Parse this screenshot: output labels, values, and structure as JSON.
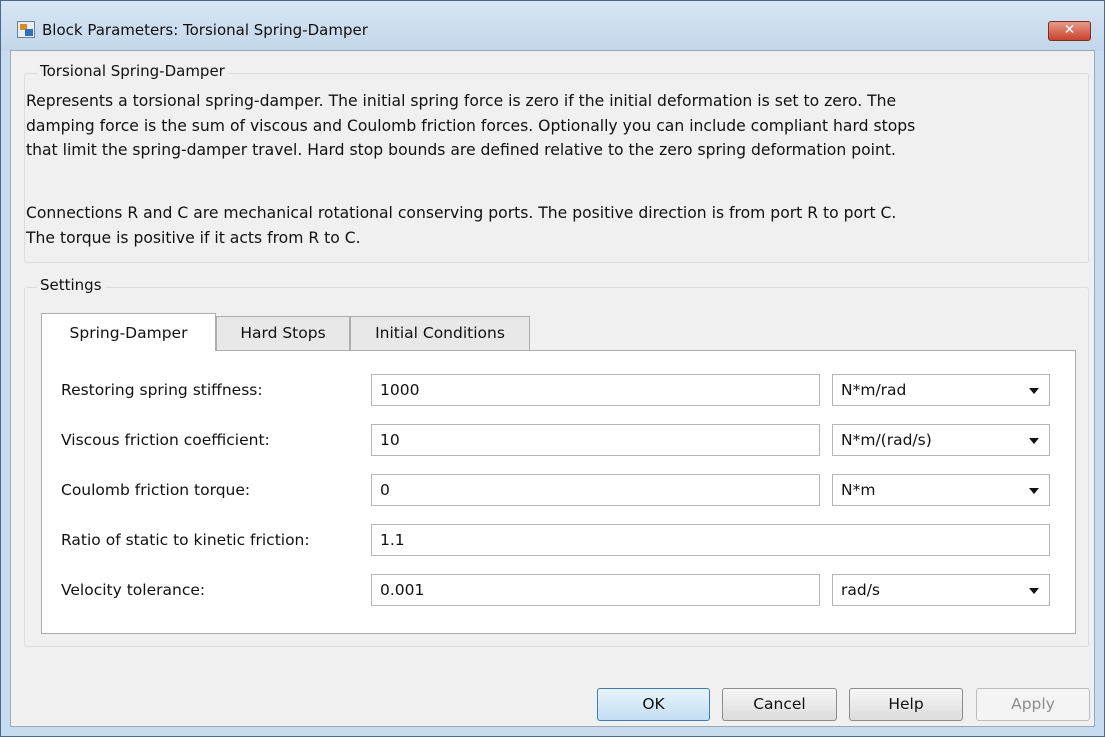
{
  "window": {
    "title": "Block Parameters: Torsional Spring-Damper",
    "close_label": "✕"
  },
  "description_group": {
    "title": "Torsional Spring-Damper",
    "lines": [
      "Represents a torsional spring-damper. The initial spring force is zero if the initial deformation is set to zero. The",
      "damping force is the sum of viscous and Coulomb friction forces. Optionally you can include compliant hard stops",
      "that limit the spring-damper travel. Hard stop bounds are defined relative to the zero spring deformation point.",
      "Connections R and C are mechanical rotational conserving ports. The positive direction is from port R to port C.",
      "The torque is positive if it acts from R to C."
    ]
  },
  "settings": {
    "title": "Settings",
    "tabs": [
      {
        "label": "Spring-Damper",
        "active": true
      },
      {
        "label": "Hard Stops",
        "active": false
      },
      {
        "label": "Initial Conditions",
        "active": false
      }
    ],
    "parameters": [
      {
        "label": "Restoring spring stiffness:",
        "value": "1000",
        "unit": "N*m/rad"
      },
      {
        "label": "Viscous friction coefficient:",
        "value": "10",
        "unit": "N*m/(rad/s)"
      },
      {
        "label": "Coulomb friction torque:",
        "value": "0",
        "unit": "N*m"
      },
      {
        "label": "Ratio of static to kinetic friction:",
        "value": "1.1",
        "unit": ""
      },
      {
        "label": "Velocity tolerance:",
        "value": "0.001",
        "unit": "rad/s"
      }
    ]
  },
  "buttons": {
    "ok": "OK",
    "cancel": "Cancel",
    "help": "Help",
    "apply": "Apply"
  },
  "colors": {
    "window_frame": "#c9dcef",
    "client_background": "#f0f0f0",
    "close_button": "#c8432d",
    "default_button_border": "#3c7fb1"
  },
  "icons": {
    "app": "block-parameters-icon",
    "close": "close-icon",
    "dropdown": "chevron-down-icon"
  }
}
